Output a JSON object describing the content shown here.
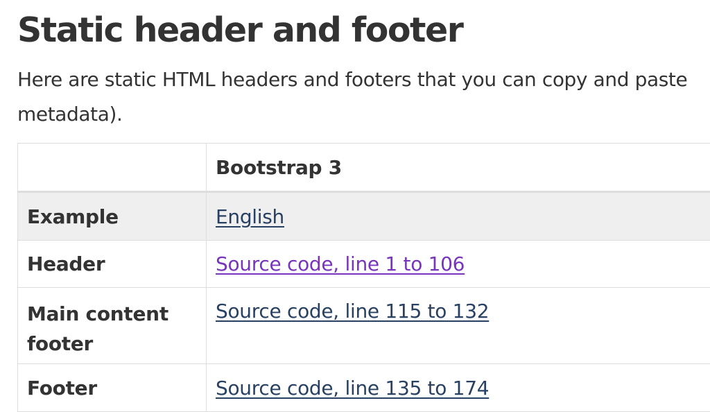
{
  "heading": "Static header and footer",
  "intro": {
    "line1": "Here are static HTML headers and footers that you can copy and paste",
    "line2": "metadata)."
  },
  "table": {
    "header": {
      "empty": "",
      "col2": "Bootstrap 3"
    },
    "rows": [
      {
        "label": "Example",
        "link": "English",
        "visited": false
      },
      {
        "label": "Header",
        "link": "Source code, line 1 to 106",
        "visited": true
      },
      {
        "label_line1": "Main content",
        "label_line2": "footer",
        "link": "Source code, line 115 to 132",
        "visited": false
      },
      {
        "label": "Footer",
        "link": "Source code, line 135 to 174",
        "visited": false
      }
    ]
  },
  "colors": {
    "text": "#333333",
    "link": "#284162",
    "link_visited": "#7834bc",
    "stripe": "#efefef",
    "border": "#dddddd"
  }
}
